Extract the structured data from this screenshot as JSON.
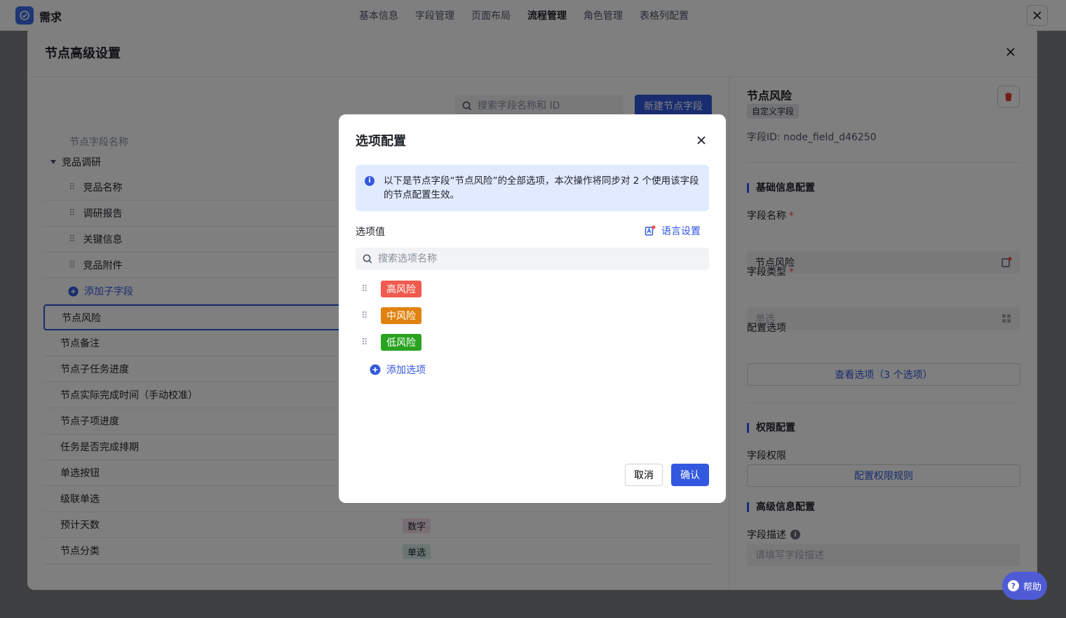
{
  "app": {
    "title": "需求"
  },
  "top_tabs": [
    {
      "label": "基本信息"
    },
    {
      "label": "字段管理"
    },
    {
      "label": "页面布局"
    },
    {
      "label": "流程管理"
    },
    {
      "label": "角色管理"
    },
    {
      "label": "表格列配置"
    }
  ],
  "panel": {
    "title": "节点高级设置",
    "search_placeholder": "搜索字段名称和 ID",
    "new_button": "新建节点字段",
    "column_header": "节点字段名称",
    "group": {
      "name": "竞品调研",
      "children": [
        "竞品名称",
        "调研报告",
        "关键信息",
        "竞品附件"
      ],
      "add_child": "添加子字段"
    },
    "fields": [
      {
        "name": "节点风险",
        "type": ""
      },
      {
        "name": "节点备注",
        "type": ""
      },
      {
        "name": "节点子任务进度",
        "type": ""
      },
      {
        "name": "节点实际完成时间（手动校准）",
        "type": ""
      },
      {
        "name": "节点子项进度",
        "type": ""
      },
      {
        "name": "任务是否完成排期",
        "type": ""
      },
      {
        "name": "单选按钮",
        "type": ""
      },
      {
        "name": "级联单选",
        "type": ""
      },
      {
        "name": "预计天数",
        "type": "数字"
      },
      {
        "name": "节点分类",
        "type": "单选"
      }
    ]
  },
  "right": {
    "title": "节点风险",
    "tag": "自定义字段",
    "field_id": "字段ID:  node_field_d46250",
    "basic_section": "基础信息配置",
    "field_name_label": "字段名称",
    "field_name_value": "节点风险",
    "field_type_label": "字段类型",
    "field_type_value": "单选",
    "options_label": "配置选项",
    "options_button": "查看选项（3 个选项）",
    "perm_section": "权限配置",
    "perm_label": "字段权限",
    "perm_button": "配置权限规则",
    "adv_section": "高级信息配置",
    "desc_label": "字段描述",
    "desc_placeholder": "请填写字段描述"
  },
  "modal": {
    "title": "选项配置",
    "info": "以下是节点字段“节点风险”的全部选项，本次操作将同步对 2 个使用该字段的节点配置生效。",
    "options_label": "选项值",
    "lang_button": "语言设置",
    "search_placeholder": "搜索选项名称",
    "options": [
      {
        "label": "高风险",
        "color": "#f05a4f"
      },
      {
        "label": "中风险",
        "color": "#e0820f"
      },
      {
        "label": "低风险",
        "color": "#2aa321"
      }
    ],
    "add_option": "添加选项",
    "cancel": "取消",
    "confirm": "确认"
  },
  "help": {
    "label": "帮助"
  },
  "colors": {
    "accent": "#3358e0"
  }
}
